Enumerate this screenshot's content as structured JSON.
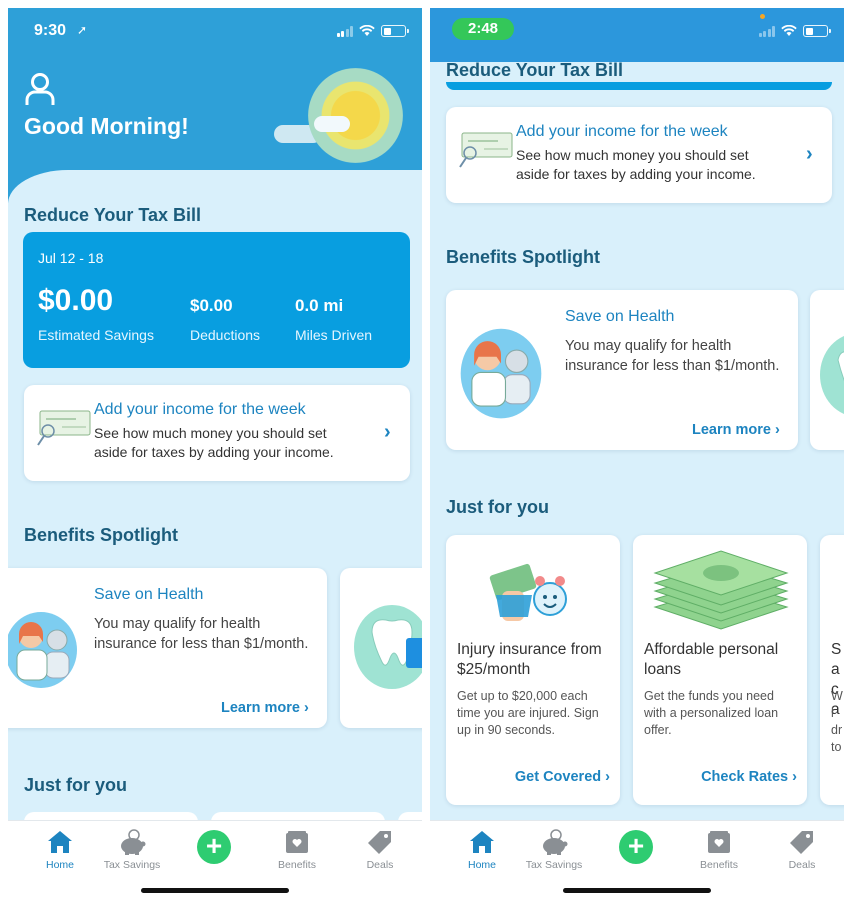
{
  "left": {
    "status": {
      "time": "9:30"
    },
    "greeting": "Good Morning!",
    "reduce_title": "Reduce Your Tax Bill",
    "savings": {
      "range": "Jul 12 - 18",
      "estimated_value": "$0.00",
      "estimated_label": "Estimated Savings",
      "deductions_value": "$0.00",
      "deductions_label": "Deductions",
      "miles_value": "0.0 mi",
      "miles_label": "Miles Driven"
    },
    "income": {
      "title": "Add your income for the week",
      "desc": "See how much money you should set aside for taxes by adding your income."
    },
    "benefits_title": "Benefits Spotlight",
    "benefit": {
      "title": "Save on Health",
      "desc": "You may qualify for health insurance for less than $1/month.",
      "link": "Learn more"
    },
    "jfy_title": "Just for you"
  },
  "right": {
    "status": {
      "time": "2:48"
    },
    "reduce_title": "Reduce Your Tax Bill",
    "income": {
      "title": "Add your income for the week",
      "desc": "See how much money you should set aside for taxes by adding your income."
    },
    "benefits_title": "Benefits Spotlight",
    "benefit": {
      "title": "Save on Health",
      "desc": "You may qualify for health insurance for less than $1/month.",
      "link": "Learn more"
    },
    "jfy_title": "Just for you",
    "jfy_cards": [
      {
        "title": "Injury insurance from $25/month",
        "desc": "Get up to $20,000 each time you are injured. Sign up in 90 seconds.",
        "link": "Get Covered"
      },
      {
        "title": "Affordable personal loans",
        "desc": "Get the funds you need with a personalized loan offer.",
        "link": "Check Rates"
      },
      {
        "title": "Sa ca",
        "desc": "Wl dr to"
      }
    ]
  },
  "tabs": [
    {
      "label": "Home",
      "icon": "home-icon"
    },
    {
      "label": "Tax Savings",
      "icon": "piggy-bank-icon"
    },
    {
      "label": "",
      "icon": "plus-icon"
    },
    {
      "label": "Benefits",
      "icon": "benefits-box-icon"
    },
    {
      "label": "Deals",
      "icon": "tag-icon"
    }
  ],
  "colors": {
    "primary": "#2ea0d8",
    "card_blue": "#089ee0",
    "accent_green": "#2ecc71",
    "link_blue": "#1d84c0",
    "heading": "#1b5c7c",
    "background": "#d9f0fb"
  }
}
